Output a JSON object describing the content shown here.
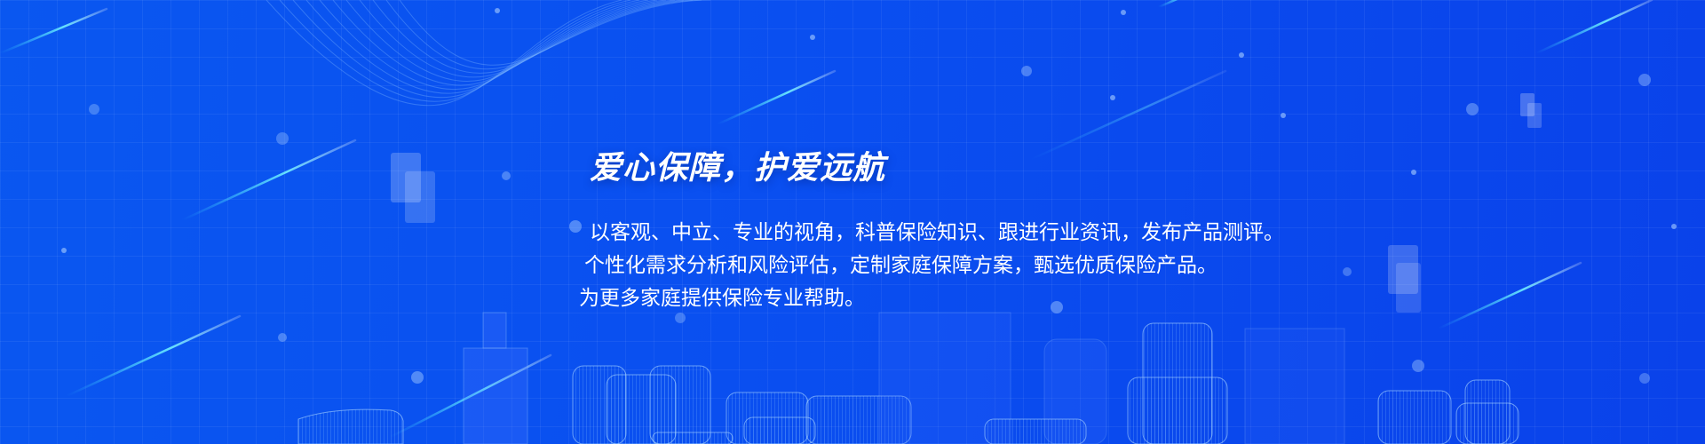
{
  "banner": {
    "headline": "爱心保障，护爱远航",
    "description_lines": [
      "以客观、中立、专业的视角，科普保险知识、跟进行业资讯，发布产品测评。",
      "个性化需求分析和风险评估，定制家庭保障方案，甄选优质保险产品。",
      "为更多家庭提供保险专业帮助。"
    ]
  },
  "colors": {
    "background": "#0a4ff0",
    "accent_cyan": "#3fe6ff",
    "text": "#ffffff"
  },
  "decorations": {
    "background_art": "city-wireframe",
    "lines": "light-streaks",
    "waves": "wave-lines"
  }
}
